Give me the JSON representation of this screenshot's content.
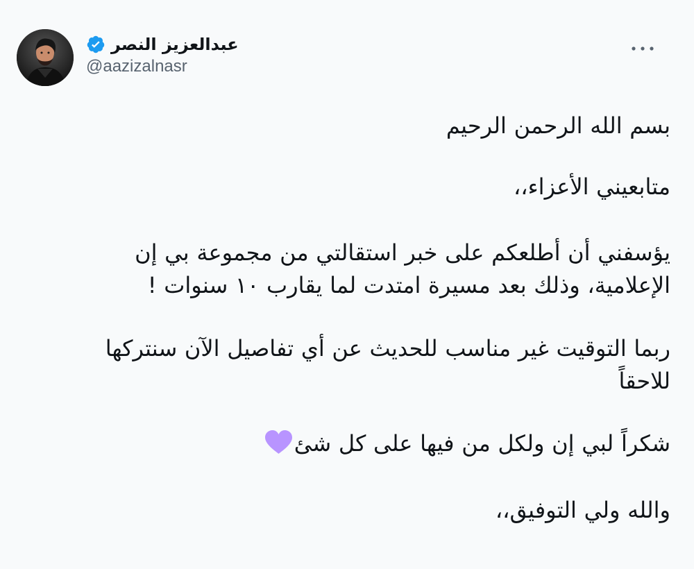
{
  "user": {
    "display_name": "عبدالعزيز النصر",
    "handle": "@aazizalnasr",
    "verified_icon": "verified-badge-icon",
    "avatar_icon": "profile-photo"
  },
  "menu": {
    "more_icon": "more-options-icon"
  },
  "tweet": {
    "paragraphs": [
      "بسم الله الرحمن الرحيم",
      "متابعيني الأعزاء،،",
      "يؤسفني أن أطلعكم على خبر استقالتي من مجموعة بي إن",
      "الإعلامية، وذلك بعد مسيرة امتدت لما يقارب ١٠ سنوات !",
      "ربما التوقيت غير مناسب للحديث عن أي تفاصيل الآن سنتركها",
      "للاحقاً",
      "شكراً لبي إن ولكل من فيها على كل شئ",
      "والله ولي التوفيق،،"
    ],
    "emoji": "purple-heart-icon"
  },
  "colors": {
    "background": "#f8fafb",
    "text": "#101418",
    "secondary_text": "#58636f",
    "verified": "#1d9bf0",
    "heart": "#b894ff"
  }
}
